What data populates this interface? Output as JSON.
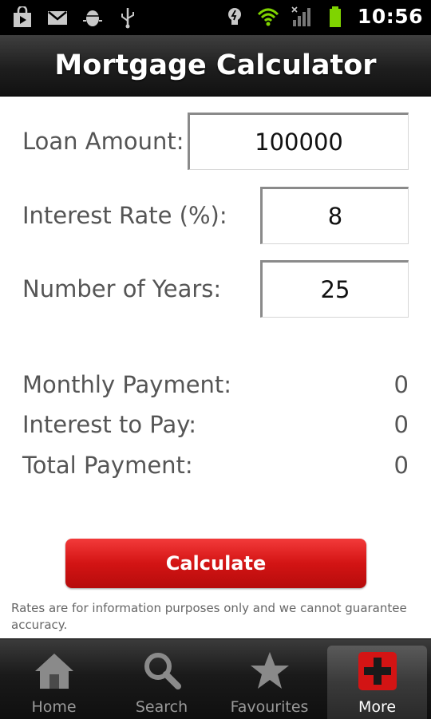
{
  "status_bar": {
    "time": "10:56",
    "icons_left": [
      "shopping-bag-icon",
      "gmail-icon",
      "android-debug-icon",
      "usb-icon"
    ],
    "icons_right": [
      "lightbulb-icon",
      "wifi-icon",
      "signal-icon",
      "battery-icon"
    ]
  },
  "header": {
    "title": "Mortgage Calculator"
  },
  "form": {
    "loan_amount": {
      "label": "Loan Amount:",
      "value": "100000"
    },
    "interest_rate": {
      "label": "Interest Rate (%):",
      "value": "8"
    },
    "years": {
      "label": "Number of Years:",
      "value": "25"
    }
  },
  "results": {
    "monthly_payment": {
      "label": "Monthly Payment:",
      "value": "0"
    },
    "interest_to_pay": {
      "label": "Interest to Pay:",
      "value": "0"
    },
    "total_payment": {
      "label": "Total Payment:",
      "value": "0"
    }
  },
  "calculate_label": "Calculate",
  "disclaimer": "Rates are for information purposes only and we cannot guarantee accuracy.",
  "tabs": [
    {
      "label": "Home",
      "icon": "home-icon",
      "active": false
    },
    {
      "label": "Search",
      "icon": "search-icon",
      "active": false
    },
    {
      "label": "Favourites",
      "icon": "star-icon",
      "active": false
    },
    {
      "label": "More",
      "icon": "plus-icon",
      "active": true
    }
  ],
  "colors": {
    "accent_red": "#d31414",
    "status_green": "#7fd400"
  }
}
